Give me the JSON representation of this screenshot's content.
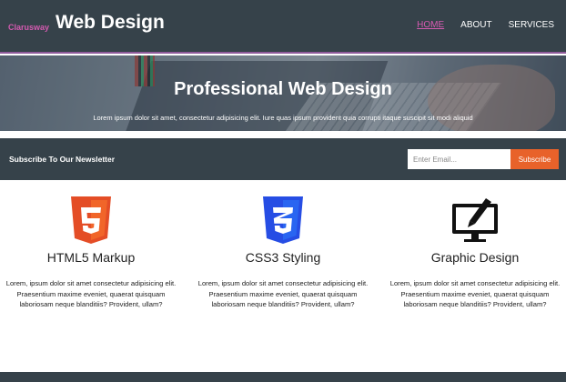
{
  "header": {
    "brand_small": "Clarusway",
    "brand_title": "Web Design",
    "nav": [
      {
        "label": "HOME",
        "active": true
      },
      {
        "label": "ABOUT",
        "active": false
      },
      {
        "label": "SERVICES",
        "active": false
      }
    ]
  },
  "hero": {
    "title": "Professional Web Design",
    "subtitle": "Lorem ipsum dolor sit amet, consectetur adipisicing elit. Iure quas ipsum provident quia corrupti itaque suscipit sit modi aliquid"
  },
  "newsletter": {
    "title": "Subscribe To Our Newsletter",
    "email_placeholder": "Enter Email...",
    "button_label": "Subscribe"
  },
  "features": [
    {
      "icon": "html5-icon",
      "title": "HTML5 Markup",
      "description": "Lorem, ipsum dolor sit amet consectetur adipisicing elit. Praesentium maxime eveniet, quaerat quisquam laboriosam neque blanditiis? Provident, ullam?"
    },
    {
      "icon": "css3-icon",
      "title": "CSS3 Styling",
      "description": "Lorem, ipsum dolor sit amet consectetur adipisicing elit. Praesentium maxime eveniet, quaerat quisquam laboriosam neque blanditiis? Provident, ullam?"
    },
    {
      "icon": "graphic-design-icon",
      "title": "Graphic Design",
      "description": "Lorem, ipsum dolor sit amet consectetur adipisicing elit. Praesentium maxime eveniet, quaerat quisquam laboriosam neque blanditiis? Provident, ullam?"
    }
  ],
  "colors": {
    "dark": "#36424a",
    "accent": "#d45ab0",
    "button": "#e8622a",
    "html5": "#e44d26",
    "css3": "#264de4"
  }
}
